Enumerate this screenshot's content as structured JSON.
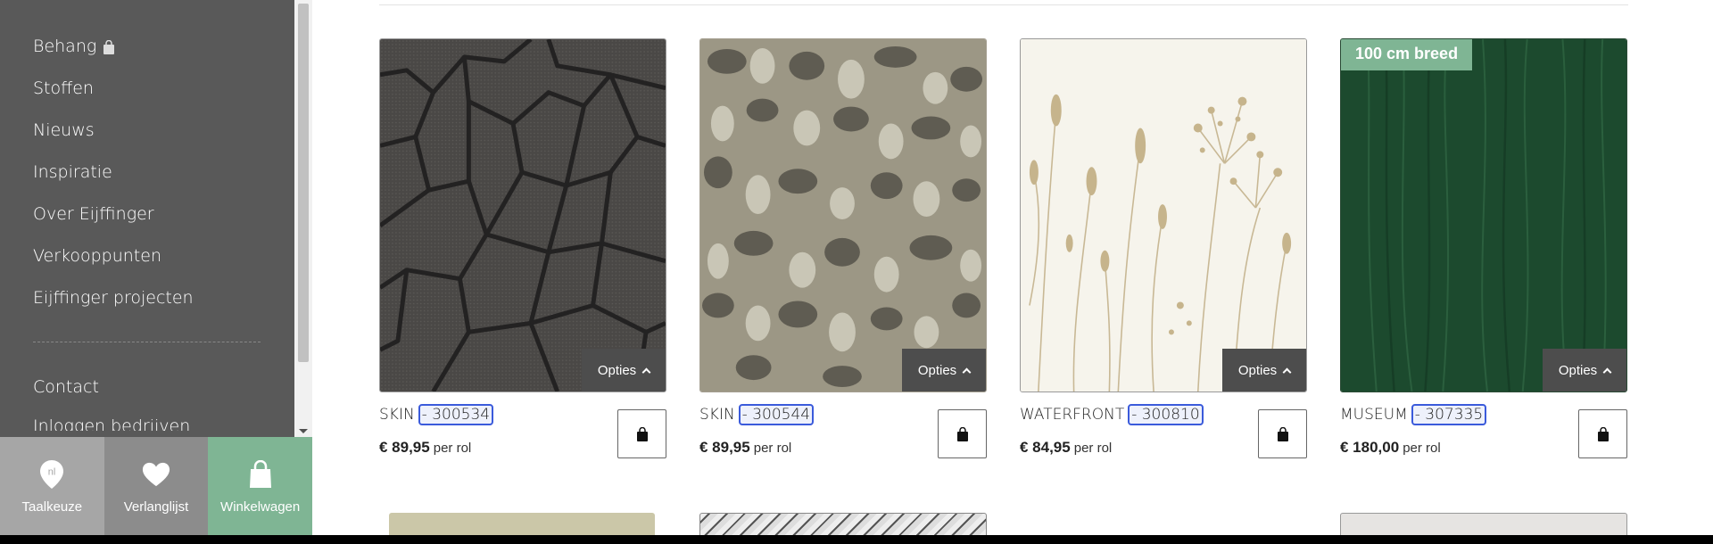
{
  "sidebar": {
    "items": [
      {
        "label": "Behang"
      },
      {
        "label": "Stoffen"
      },
      {
        "label": "Nieuws"
      },
      {
        "label": "Inspiratie"
      },
      {
        "label": "Over Eijffinger"
      },
      {
        "label": "Verkooppunten"
      },
      {
        "label": "Eijffinger projecten"
      }
    ],
    "secondary": [
      {
        "label": "Contact"
      },
      {
        "label": "Inloggen bedrijven"
      }
    ]
  },
  "bottom_bar": {
    "language": {
      "label": "Taalkeuze",
      "code": "nl"
    },
    "wishlist": {
      "label": "Verlanglijst"
    },
    "cart": {
      "label": "Winkelwagen"
    }
  },
  "products": [
    {
      "name": "SKIN",
      "code": "- 300534",
      "price": "€ 89,95",
      "unit": "per rol",
      "options": "Opties",
      "badge": ""
    },
    {
      "name": "SKIN",
      "code": "- 300544",
      "price": "€ 89,95",
      "unit": "per rol",
      "options": "Opties",
      "badge": ""
    },
    {
      "name": "WATERFRONT",
      "code": "- 300810",
      "price": "€ 84,95",
      "unit": "per rol",
      "options": "Opties",
      "badge": ""
    },
    {
      "name": "MUSEUM",
      "code": "- 307335",
      "price": "€ 180,00",
      "unit": "per rol",
      "options": "Opties",
      "badge": "100 cm breed"
    }
  ],
  "colors": {
    "sidebar_bg": "#595959",
    "accent_green": "#7fb594",
    "options_bg": "#4d4d4d",
    "code_highlight": "#3b5bdb"
  },
  "icons": {
    "language": "location-pin-icon",
    "wishlist": "heart-icon",
    "cart": "shopping-bag-icon"
  }
}
